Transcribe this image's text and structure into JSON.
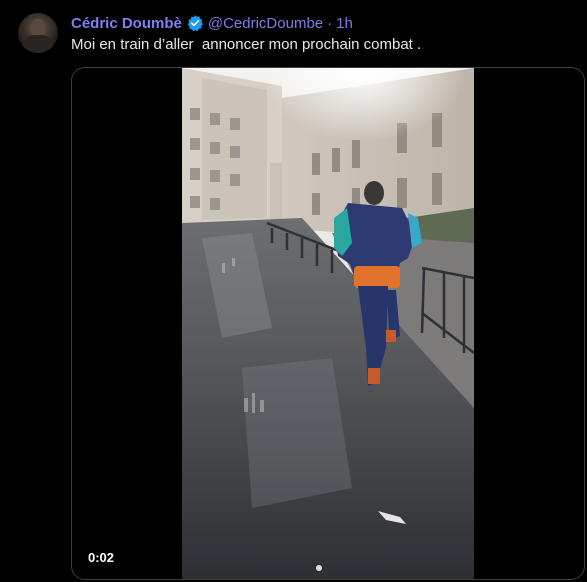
{
  "tweet": {
    "author_name": "Cédric Doumbè",
    "handle": "@CedricDoumbe",
    "separator": "·",
    "time": "1h",
    "text": "Moi en train d’aller  annoncer mon prochain combat ."
  },
  "media": {
    "video_time": "0:02"
  },
  "colors": {
    "name": "#7d7ff2",
    "verified": "#1d9bf0",
    "text": "#e7e9ea",
    "background": "#000000"
  },
  "icons": {
    "verified": "verified-badge-icon"
  }
}
